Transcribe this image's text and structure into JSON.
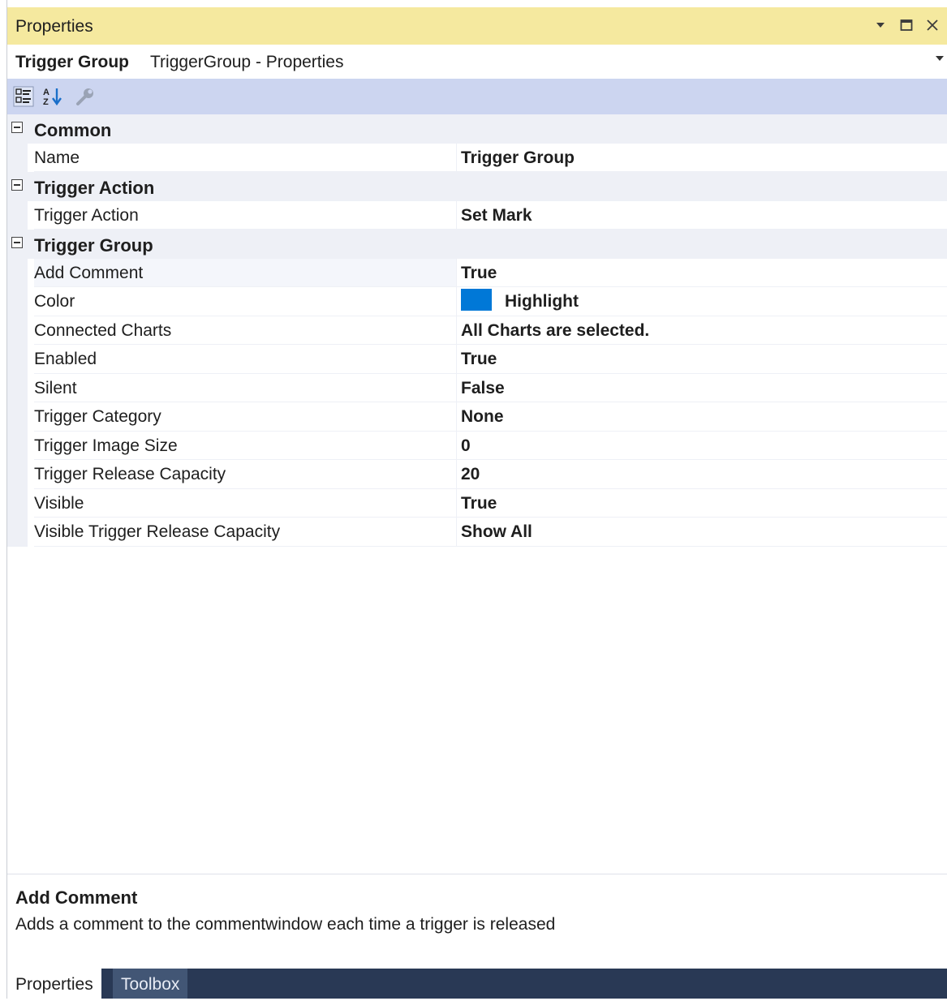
{
  "window": {
    "title": "Properties",
    "buttons": [
      "dropdown",
      "maximize",
      "close"
    ]
  },
  "object_selector": {
    "name": "Trigger Group",
    "type": "TriggerGroup - Properties"
  },
  "toolbar": {
    "items": [
      "categorized-view",
      "alphabetical-sort",
      "property-pages"
    ]
  },
  "grid": {
    "categories": [
      {
        "name": "Common",
        "properties": [
          {
            "name": "Name",
            "value": "Trigger Group"
          }
        ]
      },
      {
        "name": "Trigger Action",
        "properties": [
          {
            "name": "Trigger Action",
            "value": "Set Mark"
          }
        ]
      },
      {
        "name": "Trigger Group",
        "properties": [
          {
            "name": "Add Comment",
            "value": "True"
          },
          {
            "name": "Color",
            "value": "Highlight",
            "swatch": "#0078d7"
          },
          {
            "name": "Connected Charts",
            "value": "All Charts are selected."
          },
          {
            "name": "Enabled",
            "value": "True"
          },
          {
            "name": "Silent",
            "value": "False"
          },
          {
            "name": "Trigger Category",
            "value": "None"
          },
          {
            "name": "Trigger Image Size",
            "value": "0"
          },
          {
            "name": "Trigger Release Capacity",
            "value": "20"
          },
          {
            "name": "Visible",
            "value": "True"
          },
          {
            "name": "Visible Trigger Release Capacity",
            "value": "Show All"
          }
        ]
      }
    ]
  },
  "description": {
    "title": "Add Comment",
    "text": "Adds a comment to the commentwindow each time a trigger is released"
  },
  "tabs": [
    {
      "label": "Properties",
      "active": true
    },
    {
      "label": "Toolbox",
      "active": false
    }
  ],
  "colors": {
    "titlebar": "#f5e99f",
    "toolbar": "#ccd5f0",
    "category_bg": "#eef0f6",
    "tabbar": "#293955",
    "swatch": "#0078d7"
  }
}
